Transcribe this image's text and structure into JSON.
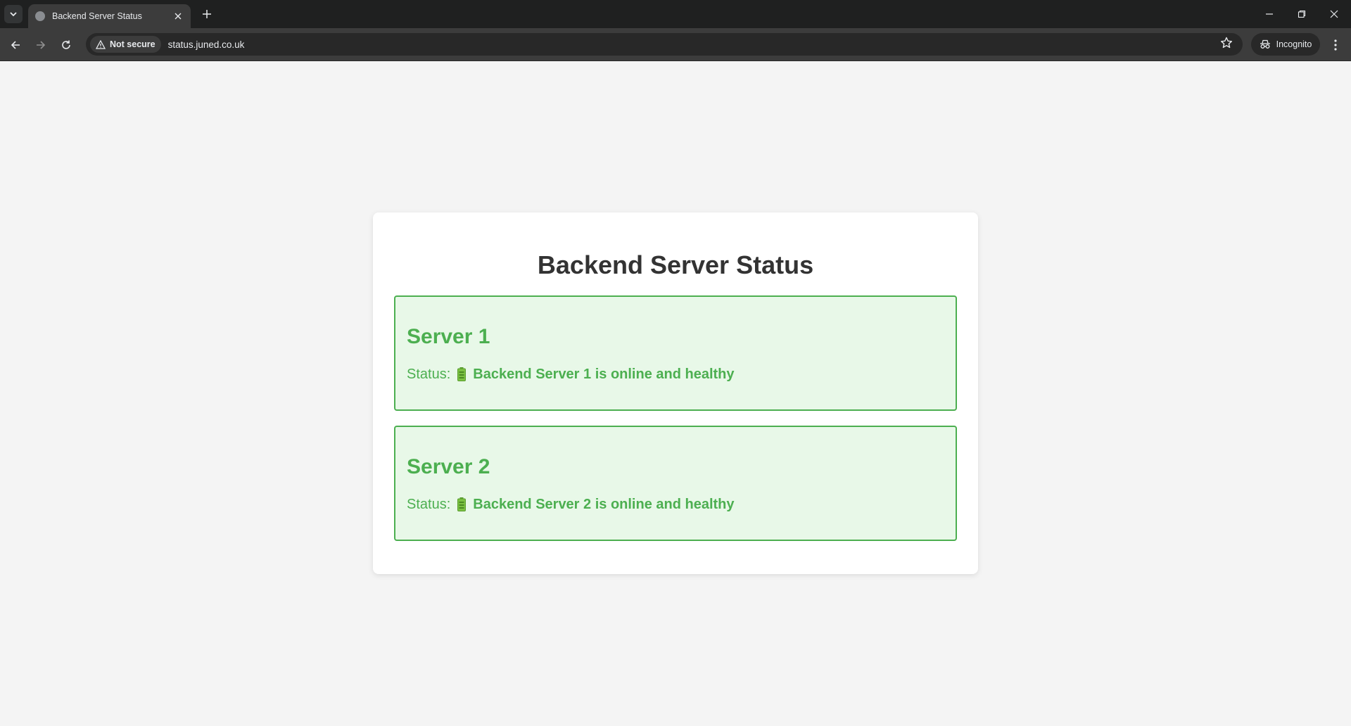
{
  "browser": {
    "tab_title": "Backend Server Status",
    "security_label": "Not secure",
    "url": "status.juned.co.uk",
    "incognito_label": "Incognito"
  },
  "page": {
    "title": "Backend Server Status",
    "servers": [
      {
        "name": "Server 1",
        "status_label": "Status:",
        "status_text": "Backend Server 1 is online and healthy"
      },
      {
        "name": "Server 2",
        "status_label": "Status:",
        "status_text": "Backend Server 2 is online and healthy"
      }
    ]
  },
  "colors": {
    "healthy_green": "#4caf50",
    "healthy_bg": "#e8f8e8",
    "battery_green": "#7bc142"
  },
  "icons": [
    "tab-list-icon",
    "globe-icon",
    "close-icon",
    "plus-icon",
    "minimize-icon",
    "restore-icon",
    "back-arrow-icon",
    "forward-arrow-icon",
    "reload-icon",
    "warning-icon",
    "star-icon",
    "incognito-icon",
    "kebab-menu-icon",
    "battery-icon"
  ]
}
